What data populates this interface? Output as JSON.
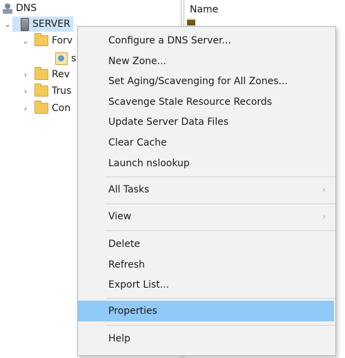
{
  "tree": {
    "root_label": "DNS",
    "server_label": "SERVER",
    "forward_label": "Forv",
    "zone_label": "s",
    "reverse_label": "Rev",
    "trust_label": "Trus",
    "cond_label": "Con"
  },
  "list": {
    "header_name": "Name"
  },
  "context_menu": {
    "items": [
      {
        "label": "Configure a DNS Server..."
      },
      {
        "label": "New Zone..."
      },
      {
        "label": "Set Aging/Scavenging for All Zones..."
      },
      {
        "label": "Scavenge Stale Resource Records"
      },
      {
        "label": "Update Server Data Files"
      },
      {
        "label": "Clear Cache"
      },
      {
        "label": "Launch nslookup"
      },
      {
        "label": "All Tasks",
        "submenu": true
      },
      {
        "label": "View",
        "submenu": true
      },
      {
        "label": "Delete"
      },
      {
        "label": "Refresh"
      },
      {
        "label": "Export List..."
      },
      {
        "label": "Properties",
        "highlighted": true
      },
      {
        "label": "Help"
      }
    ],
    "submenu_arrow": "›",
    "highlight_color": "#91c9f7"
  },
  "icons": {
    "expanded": "⌄",
    "collapsed": "›"
  }
}
